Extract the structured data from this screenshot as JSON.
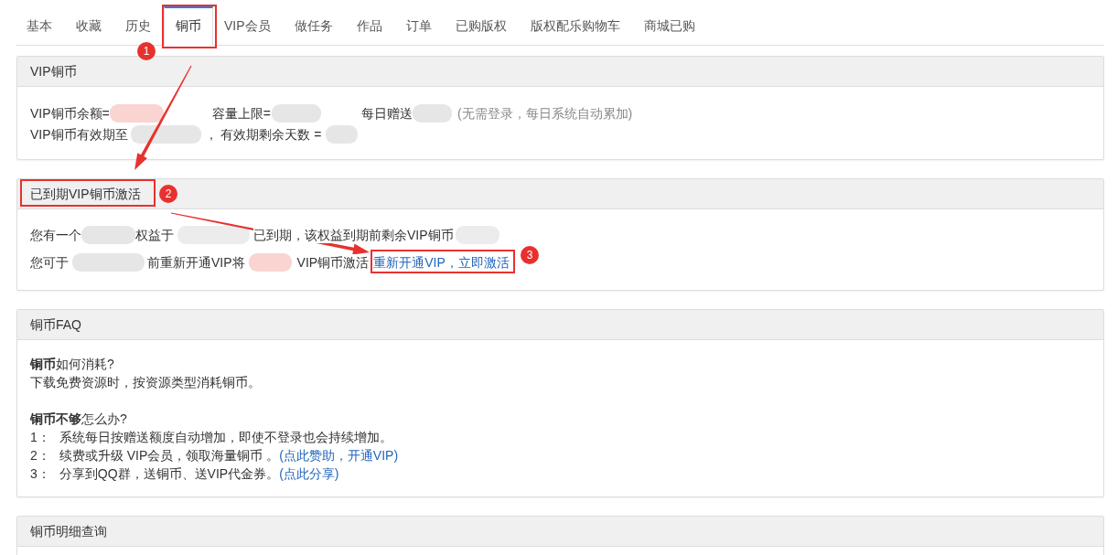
{
  "tabs": [
    {
      "label": "基本",
      "selected": false
    },
    {
      "label": "收藏",
      "selected": false
    },
    {
      "label": "历史",
      "selected": false
    },
    {
      "label": "铜币",
      "selected": true
    },
    {
      "label": "VIP会员",
      "selected": false
    },
    {
      "label": "做任务",
      "selected": false
    },
    {
      "label": "作品",
      "selected": false
    },
    {
      "label": "订单",
      "selected": false
    },
    {
      "label": "已购版权",
      "selected": false
    },
    {
      "label": "版权配乐购物车",
      "selected": false
    },
    {
      "label": "商城已购",
      "selected": false
    }
  ],
  "panels": [
    {
      "kind": "info",
      "title": "VIP铜币",
      "lines": [
        [
          {
            "kind": "text",
            "text": "VIP铜币余额="
          },
          {
            "kind": "blurred",
            "color": "#fad4d0"
          },
          {
            "kind": "text",
            "text": "容量上限="
          },
          {
            "kind": "blurred",
            "color": "#e6e6e6"
          },
          {
            "kind": "text",
            "text": "每日赠送"
          },
          {
            "kind": "blurred",
            "color": "#e6e6e6"
          },
          {
            "kind": "note",
            "text": "(无需登录，每日系统自动累加)"
          }
        ],
        [
          {
            "kind": "text",
            "text": "VIP铜币有效期至"
          },
          {
            "kind": "blurred",
            "color": "#e6e6e6"
          },
          {
            "kind": "text",
            "text": "， 有效期剩余天数 ="
          },
          {
            "kind": "blurred",
            "color": "#e6e6e6"
          }
        ]
      ]
    },
    {
      "kind": "info",
      "title": "已到期VIP铜币激活",
      "lines": [
        [
          {
            "kind": "text",
            "text": "您有一个"
          },
          {
            "kind": "blurred",
            "color": "#e6e6e6"
          },
          {
            "kind": "text",
            "text": "权益于"
          },
          {
            "kind": "blurred",
            "color": "#ececec"
          },
          {
            "kind": "text",
            "text": "已到期，该权益到期前剩余VIP铜币"
          },
          {
            "kind": "blurred",
            "color": "#ececec"
          }
        ],
        [
          {
            "kind": "text",
            "text": "您可于"
          },
          {
            "kind": "blurred",
            "color": "#e6e6e6"
          },
          {
            "kind": "text",
            "text": "前重新开通VIP将"
          },
          {
            "kind": "blurred",
            "color": "#fad4d0"
          },
          {
            "kind": "text",
            "text": "VIP铜币激活"
          },
          {
            "kind": "link",
            "text": "重新开通VIP，立即激活"
          }
        ]
      ]
    },
    {
      "kind": "faq",
      "title": "铜币FAQ",
      "questions": [
        {
          "question": "**铜币**如何消耗?",
          "answers": [
            {
              "text": "下载免费资源时，按资源类型消耗铜币。"
            }
          ]
        },
        {
          "question": "**铜币不够**怎么办?",
          "answers": [
            {
              "number": "1：",
              "text": "系统每日按赠送额度自动增加，即使不登录也会持续增加。"
            },
            {
              "number": "2：",
              "text": "续费或升级 VIP会员，领取海量铜币 。",
              "link": "(点此赞助，开通VIP)"
            },
            {
              "number": "3：",
              "text": "分享到QQ群，送铜币、送VIP代金券。",
              "link": "(点此分享)"
            }
          ]
        }
      ]
    },
    {
      "kind": "empty",
      "title": "铜币明细查询"
    }
  ],
  "annotations": [
    {
      "number": "1"
    },
    {
      "number": "2"
    },
    {
      "number": "3"
    }
  ]
}
